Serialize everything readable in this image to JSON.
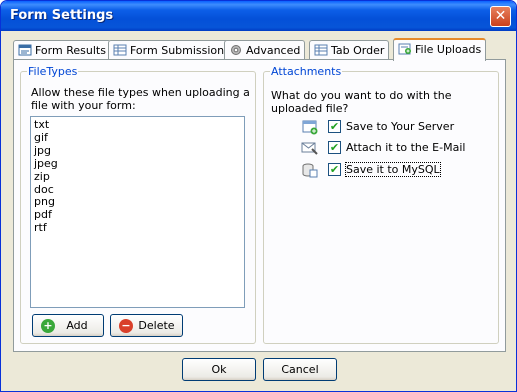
{
  "window": {
    "title": "Form Settings",
    "close_glyph": "✕"
  },
  "tabs": [
    {
      "label": "Form Results",
      "icon": "form-results-icon"
    },
    {
      "label": "Form Submission",
      "icon": "table-icon"
    },
    {
      "label": "Advanced",
      "icon": "gear-icon"
    },
    {
      "label": "Tab Order",
      "icon": "table-icon"
    },
    {
      "label": "File Uploads",
      "icon": "upload-icon",
      "active": true
    }
  ],
  "filetypes": {
    "group_label": "FileTypes",
    "description": "Allow these file types when uploading a file with your form:",
    "items": [
      "txt",
      "gif",
      "jpg",
      "jpeg",
      "zip",
      "doc",
      "png",
      "pdf",
      "rtf"
    ],
    "add_label": "Add",
    "delete_label": "Delete",
    "add_icon": "add-icon",
    "delete_icon": "delete-icon"
  },
  "attachments": {
    "group_label": "Attachments",
    "question": "What do you want to do with the uploaded file?",
    "options": [
      {
        "label": "Save to Your Server",
        "checked": true,
        "icon": "server-icon"
      },
      {
        "label": "Attach it to the E-Mail",
        "checked": true,
        "icon": "email-icon"
      },
      {
        "label": "Save it to MySQL",
        "checked": true,
        "icon": "database-icon"
      }
    ]
  },
  "footer": {
    "ok_label": "Ok",
    "cancel_label": "Cancel"
  },
  "colors": {
    "title_bar": "#0054e3",
    "group_label": "#0046d5",
    "check": "#21a121"
  }
}
